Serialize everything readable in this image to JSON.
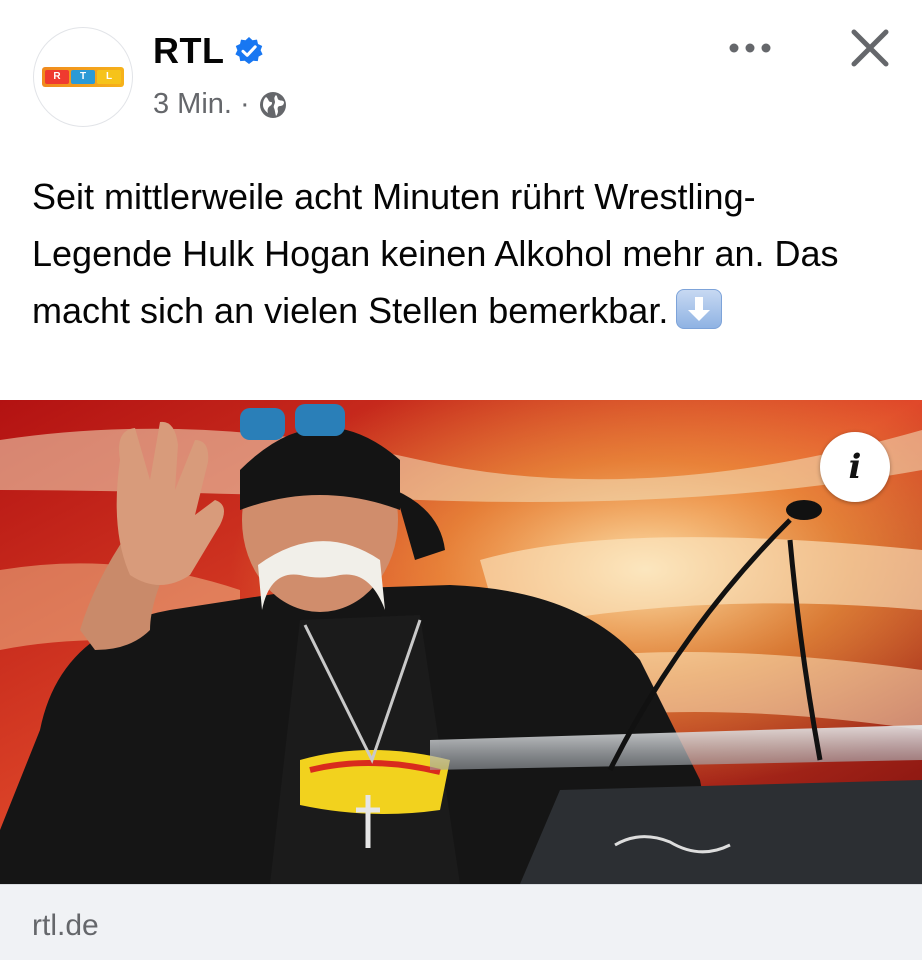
{
  "post": {
    "page_name": "RTL",
    "timestamp": "3 Min.",
    "separator": "·",
    "audience_icon": "globe-icon",
    "verified_icon": "verified-badge-icon",
    "avatar_logo_letters": [
      "R",
      "T",
      "L"
    ],
    "text": "Seit mittlerweile acht Minuten rührt Wrestling-Legende Hulk Hogan keinen Alkohol mehr an. Das macht sich an vielen Stellen bemerkbar.",
    "text_emoji": "down-arrow-emoji"
  },
  "actions": {
    "more_icon": "more-dots-icon",
    "close_icon": "close-icon",
    "info_label": "i"
  },
  "link_preview": {
    "domain": "rtl.de"
  },
  "colors": {
    "verified_blue": "#1877f2",
    "meta_gray": "#65676b",
    "preview_bg": "#f0f2f5"
  }
}
